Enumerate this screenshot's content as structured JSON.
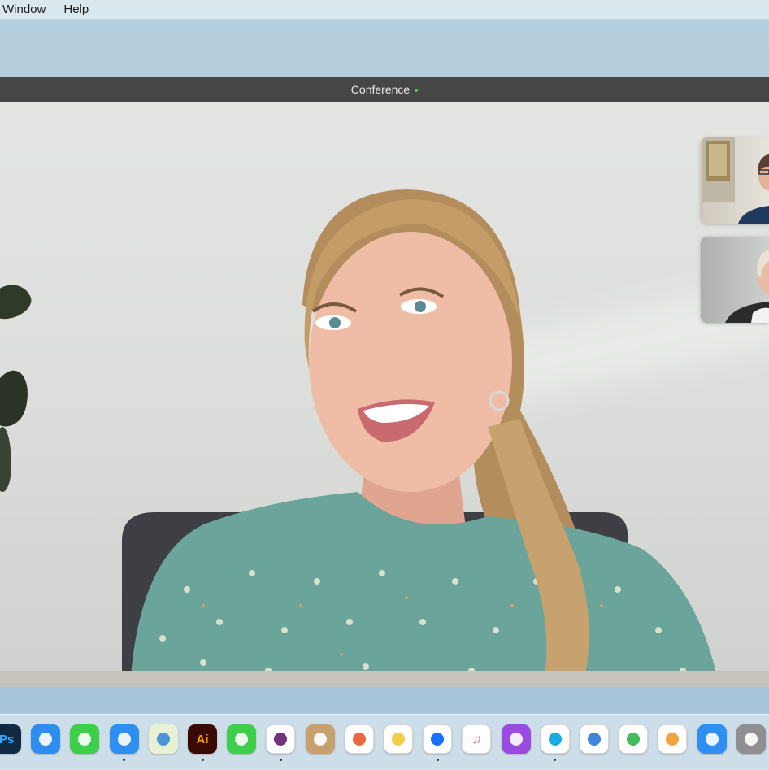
{
  "menubar": {
    "items": [
      "Window",
      "Help"
    ]
  },
  "window": {
    "title": "Conference",
    "status_color": "#3ecf4a"
  },
  "participants": [
    {
      "role": "main-speaker"
    },
    {
      "role": "thumbnail"
    },
    {
      "role": "thumbnail"
    }
  ],
  "dock": {
    "apps": [
      {
        "name": "photoshop-icon",
        "label": "Ps",
        "bg": "#0f2a43",
        "fg": "#31a8ff",
        "running": false
      },
      {
        "name": "safari-icon",
        "label": "",
        "bg": "#2d8ef0",
        "fg": "#ffffff",
        "running": false
      },
      {
        "name": "messages-icon",
        "label": "",
        "bg": "#3ecf4a",
        "fg": "#ffffff",
        "running": false
      },
      {
        "name": "mail-icon",
        "label": "",
        "bg": "#2f8ff0",
        "fg": "#ffffff",
        "running": true
      },
      {
        "name": "maps-icon",
        "label": "",
        "bg": "#e9f1d4",
        "fg": "#3a8ad8",
        "running": false
      },
      {
        "name": "illustrator-icon",
        "label": "Ai",
        "bg": "#3a0a02",
        "fg": "#ff9a00",
        "running": true
      },
      {
        "name": "facetime-icon",
        "label": "",
        "bg": "#3ecf4a",
        "fg": "#ffffff",
        "running": false
      },
      {
        "name": "slack-icon",
        "label": "",
        "bg": "#ffffff",
        "fg": "#611f69",
        "running": true
      },
      {
        "name": "contacts-icon",
        "label": "",
        "bg": "#c8a06e",
        "fg": "#ffffff",
        "running": false
      },
      {
        "name": "reminders-icon",
        "label": "",
        "bg": "#ffffff",
        "fg": "#e8562a",
        "running": false
      },
      {
        "name": "notes-icon",
        "label": "",
        "bg": "#ffffff",
        "fg": "#f5c63a",
        "running": false
      },
      {
        "name": "dropbox-icon",
        "label": "",
        "bg": "#ffffff",
        "fg": "#0061ff",
        "running": true
      },
      {
        "name": "music-icon",
        "label": "♫",
        "bg": "#ffffff",
        "fg": "#fa3c5a",
        "running": false
      },
      {
        "name": "podcasts-icon",
        "label": "",
        "bg": "#9b4be0",
        "fg": "#ffffff",
        "running": false
      },
      {
        "name": "salesforce-icon",
        "label": "",
        "bg": "#ffffff",
        "fg": "#00a1e0",
        "running": true
      },
      {
        "name": "keynote-icon",
        "label": "",
        "bg": "#ffffff",
        "fg": "#2a7ad8",
        "running": false
      },
      {
        "name": "numbers-icon",
        "label": "",
        "bg": "#ffffff",
        "fg": "#31b44a",
        "running": false
      },
      {
        "name": "pages-icon",
        "label": "",
        "bg": "#ffffff",
        "fg": "#f09a2a",
        "running": false
      },
      {
        "name": "app-store-icon",
        "label": "",
        "bg": "#2f8ff0",
        "fg": "#ffffff",
        "running": false
      },
      {
        "name": "system-preferences-icon",
        "label": "",
        "bg": "#8e8e93",
        "fg": "#ffffff",
        "running": false
      }
    ]
  }
}
